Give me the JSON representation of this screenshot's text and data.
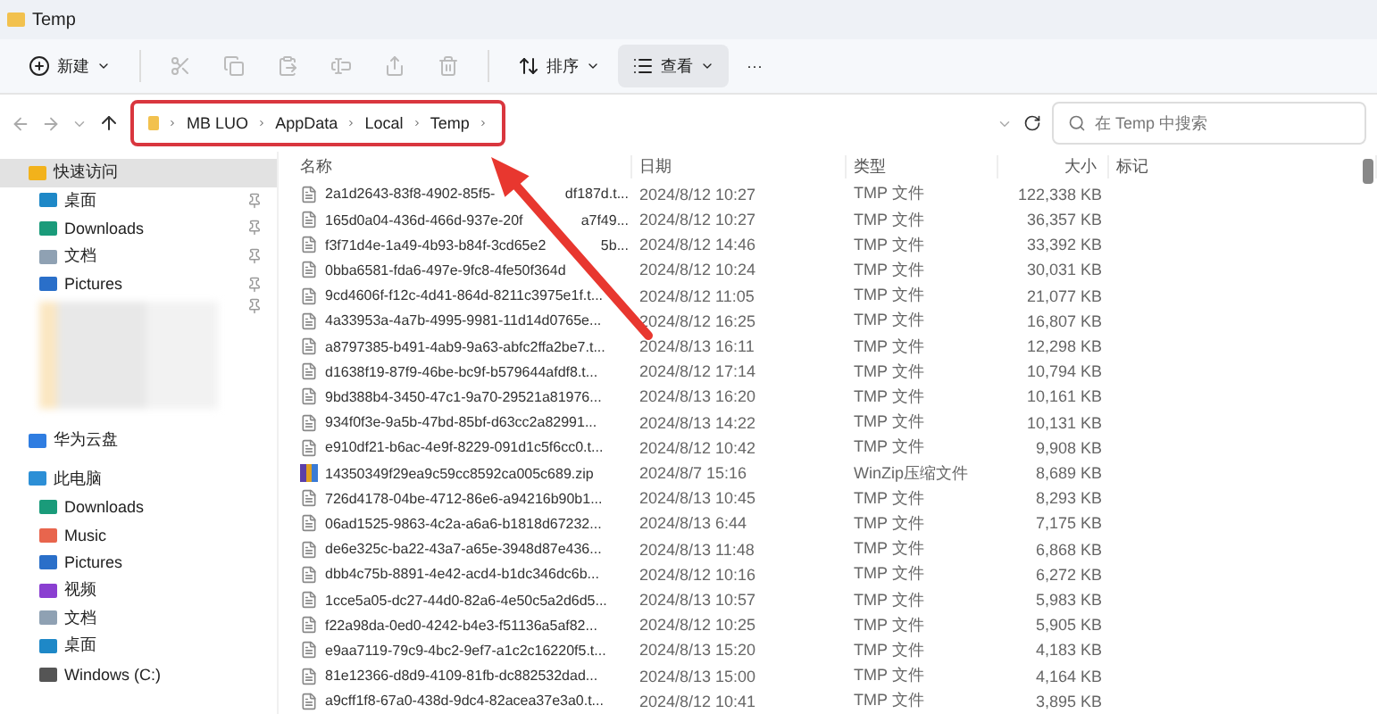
{
  "window": {
    "title": "Temp"
  },
  "toolbar": {
    "new": "新建",
    "sort": "排序",
    "view": "查看",
    "more": "···"
  },
  "address": {
    "segments": [
      "MB LUO",
      "AppData",
      "Local",
      "Temp"
    ],
    "highlighted": true,
    "search_placeholder": "在 Temp 中搜索"
  },
  "sidebar": [
    {
      "label": "快速访问",
      "kind": "star",
      "selected": true,
      "children": [
        {
          "label": "桌面",
          "kind": "desktop",
          "pinned": true
        },
        {
          "label": "Downloads",
          "kind": "download",
          "pinned": true
        },
        {
          "label": "文档",
          "kind": "docs",
          "pinned": true
        },
        {
          "label": "Pictures",
          "kind": "pictures",
          "pinned": true
        },
        {
          "kind": "blurred",
          "pinned": true
        }
      ]
    },
    {
      "label": "华为云盘",
      "kind": "cloud",
      "selected": false
    },
    {
      "label": "此电脑",
      "kind": "pc",
      "selected": false,
      "children": [
        {
          "label": "Downloads",
          "kind": "download",
          "pinned": false
        },
        {
          "label": "Music",
          "kind": "music",
          "pinned": false
        },
        {
          "label": "Pictures",
          "kind": "pictures",
          "pinned": false
        },
        {
          "label": "视频",
          "kind": "video",
          "pinned": false
        },
        {
          "label": "文档",
          "kind": "docs",
          "pinned": false
        },
        {
          "label": "桌面",
          "kind": "desktop",
          "pinned": false
        },
        {
          "label": "Windows (C:)",
          "kind": "drive",
          "pinned": false
        }
      ]
    }
  ],
  "table": {
    "columns": [
      "名称",
      "日期",
      "类型",
      "大小",
      "标记"
    ],
    "rows": [
      {
        "kind": "tmp",
        "name": "2a1d2643-83f8-4902-85f5-",
        "name_tail": "df187d.t...",
        "date": "2024/8/12 10:27",
        "type": "TMP 文件",
        "size": "122,338 KB"
      },
      {
        "kind": "tmp",
        "name": "165d0a04-436d-466d-937e-20f",
        "name_tail": "a7f49...",
        "date": "2024/8/12 10:27",
        "type": "TMP 文件",
        "size": "36,357 KB"
      },
      {
        "kind": "tmp",
        "name": "f3f71d4e-1a49-4b93-b84f-3cd65e2",
        "name_tail": "5b...",
        "date": "2024/8/12 14:46",
        "type": "TMP 文件",
        "size": "33,392 KB"
      },
      {
        "kind": "tmp",
        "name": "0bba6581-fda6-497e-9fc8-4fe50f364d",
        "date": "2024/8/12 10:24",
        "type": "TMP 文件",
        "size": "30,031 KB"
      },
      {
        "kind": "tmp",
        "name": "9cd4606f-f12c-4d41-864d-8211c3975e1f.t...",
        "date": "2024/8/12 11:05",
        "type": "TMP 文件",
        "size": "21,077 KB"
      },
      {
        "kind": "tmp",
        "name": "4a33953a-4a7b-4995-9981-11d14d0765e...",
        "date": "2024/8/12 16:25",
        "type": "TMP 文件",
        "size": "16,807 KB"
      },
      {
        "kind": "tmp",
        "name": "a8797385-b491-4ab9-9a63-abfc2ffa2be7.t...",
        "date": "2024/8/13 16:11",
        "type": "TMP 文件",
        "size": "12,298 KB"
      },
      {
        "kind": "tmp",
        "name": "d1638f19-87f9-46be-bc9f-b579644afdf8.t...",
        "date": "2024/8/12 17:14",
        "type": "TMP 文件",
        "size": "10,794 KB"
      },
      {
        "kind": "tmp",
        "name": "9bd388b4-3450-47c1-9a70-29521a81976...",
        "date": "2024/8/13 16:20",
        "type": "TMP 文件",
        "size": "10,161 KB"
      },
      {
        "kind": "tmp",
        "name": "934f0f3e-9a5b-47bd-85bf-d63cc2a82991...",
        "date": "2024/8/13 14:22",
        "type": "TMP 文件",
        "size": "10,131 KB"
      },
      {
        "kind": "tmp",
        "name": "e910df21-b6ac-4e9f-8229-091d1c5f6cc0.t...",
        "date": "2024/8/12 10:42",
        "type": "TMP 文件",
        "size": "9,908 KB"
      },
      {
        "kind": "zip",
        "name": "14350349f29ea9c59cc8592ca005c689.zip",
        "date": "2024/8/7 15:16",
        "type": "WinZip压缩文件",
        "size": "8,689 KB"
      },
      {
        "kind": "tmp",
        "name": "726d4178-04be-4712-86e6-a94216b90b1...",
        "date": "2024/8/13 10:45",
        "type": "TMP 文件",
        "size": "8,293 KB"
      },
      {
        "kind": "tmp",
        "name": "06ad1525-9863-4c2a-a6a6-b1818d67232...",
        "date": "2024/8/13 6:44",
        "type": "TMP 文件",
        "size": "7,175 KB"
      },
      {
        "kind": "tmp",
        "name": "de6e325c-ba22-43a7-a65e-3948d87e436...",
        "date": "2024/8/13 11:48",
        "type": "TMP 文件",
        "size": "6,868 KB"
      },
      {
        "kind": "tmp",
        "name": "dbb4c75b-8891-4e42-acd4-b1dc346dc6b...",
        "date": "2024/8/12 10:16",
        "type": "TMP 文件",
        "size": "6,272 KB"
      },
      {
        "kind": "tmp",
        "name": "1cce5a05-dc27-44d0-82a6-4e50c5a2d6d5...",
        "date": "2024/8/13 10:57",
        "type": "TMP 文件",
        "size": "5,983 KB"
      },
      {
        "kind": "tmp",
        "name": "f22a98da-0ed0-4242-b4e3-f51136a5af82...",
        "date": "2024/8/12 10:25",
        "type": "TMP 文件",
        "size": "5,905 KB"
      },
      {
        "kind": "tmp",
        "name": "e9aa7119-79c9-4bc2-9ef7-a1c2c16220f5.t...",
        "date": "2024/8/13 15:20",
        "type": "TMP 文件",
        "size": "4,183 KB"
      },
      {
        "kind": "tmp",
        "name": "81e12366-d8d9-4109-81fb-dc882532dad...",
        "date": "2024/8/13 15:00",
        "type": "TMP 文件",
        "size": "4,164 KB"
      },
      {
        "kind": "tmp",
        "name": "a9cff1f8-67a0-438d-9dc4-82acea37e3a0.t...",
        "date": "2024/8/12 10:41",
        "type": "TMP 文件",
        "size": "3,895 KB"
      }
    ]
  }
}
